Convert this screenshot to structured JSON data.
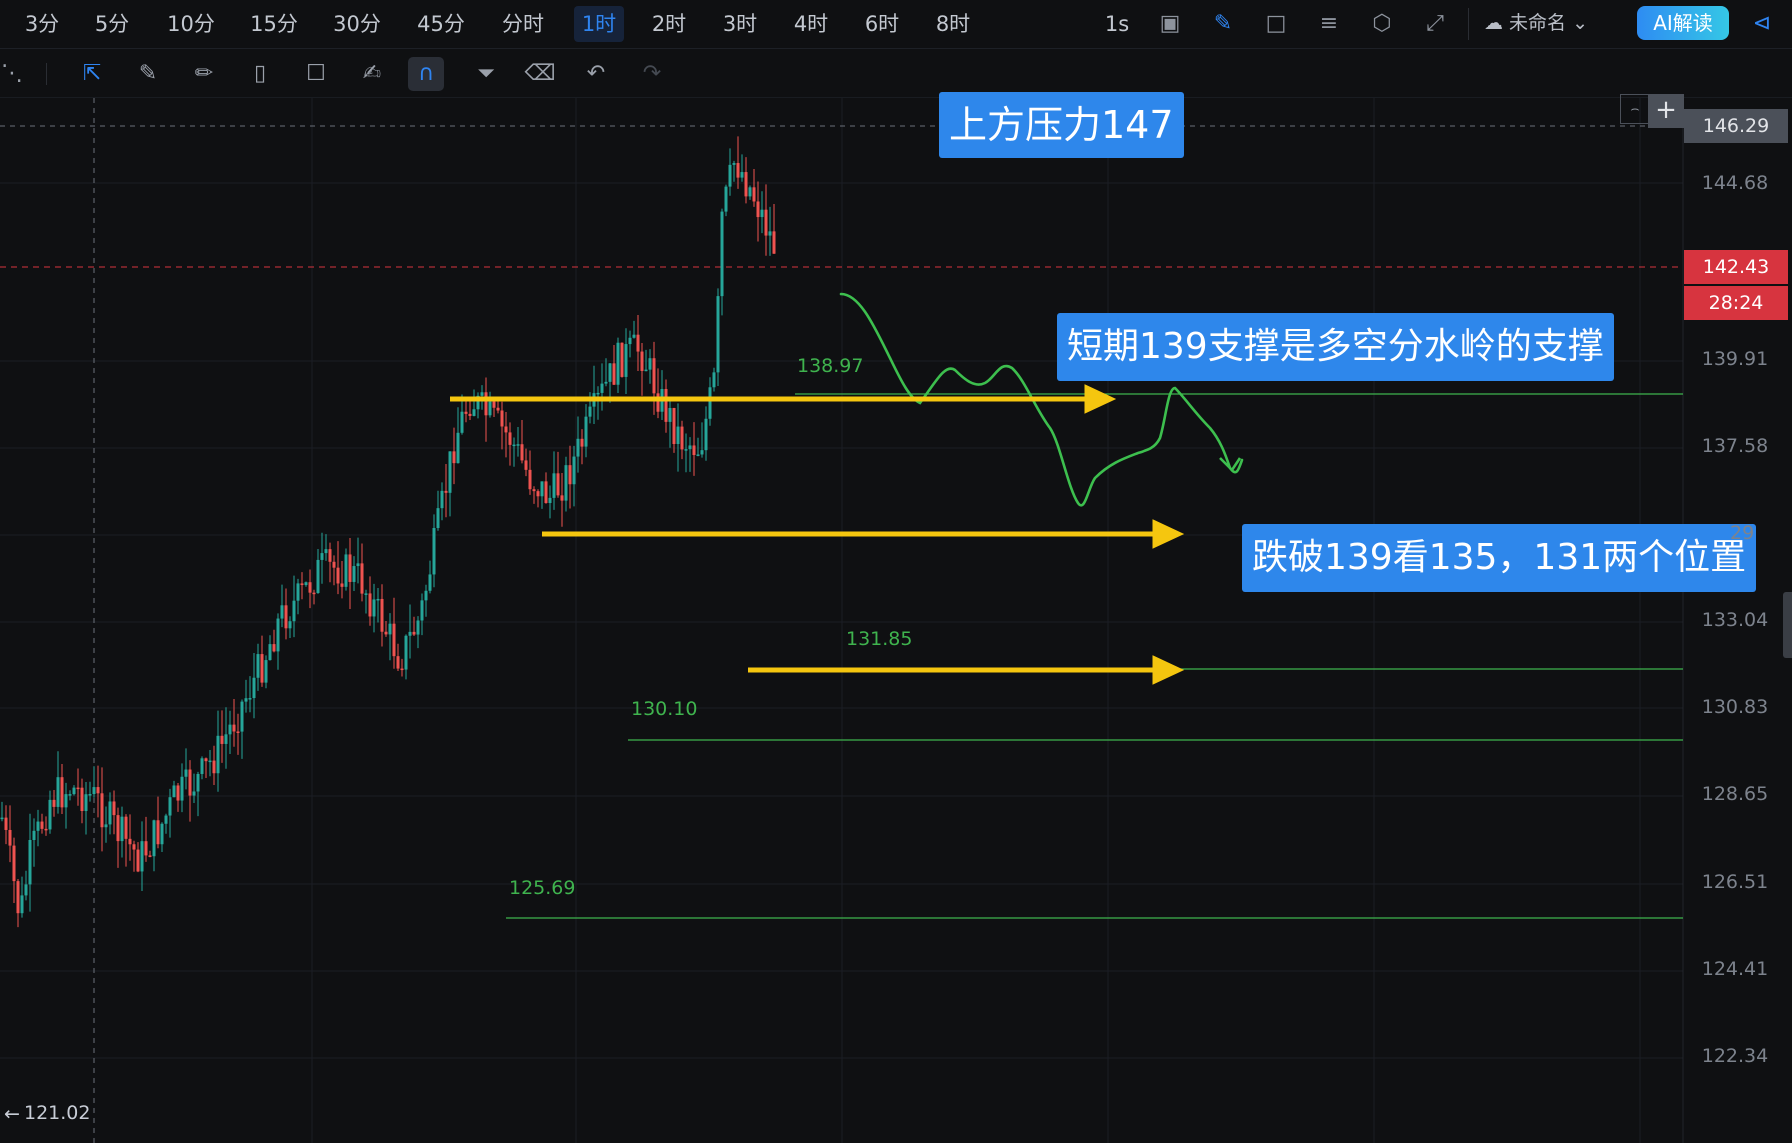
{
  "timeframes": [
    "3分",
    "5分",
    "10分",
    "15分",
    "30分",
    "45分",
    "分时",
    "1时",
    "2时",
    "3时",
    "4时",
    "6时",
    "8时"
  ],
  "active_timeframe": "1时",
  "interval_text": "1s",
  "chart_name": "未命名",
  "ai_button": "AI解读",
  "price_axis": [
    "146.29",
    "144.68",
    "139.91",
    "137.58",
    "133.04",
    "130.83",
    "128.65",
    "126.51",
    "124.41",
    "122.34"
  ],
  "partial_axis_label": "29",
  "current_price": "142.43",
  "countdown": "28:24",
  "low_marker": "121.02",
  "levels": [
    {
      "label": "138.97"
    },
    {
      "label": "131.85"
    },
    {
      "label": "130.10"
    },
    {
      "label": "125.69"
    }
  ],
  "annotations": {
    "resistance": "上方压力147",
    "support": "短期139支撑是多空分水岭的支撑",
    "breakdown": "跌破139看135，131两个位置"
  },
  "colors": {
    "up": "#26a69a",
    "down": "#ef5350",
    "arrow": "#f5c60f",
    "line": "#3fb34e",
    "callout": "#2e87eb",
    "current": "#d7343f"
  }
}
